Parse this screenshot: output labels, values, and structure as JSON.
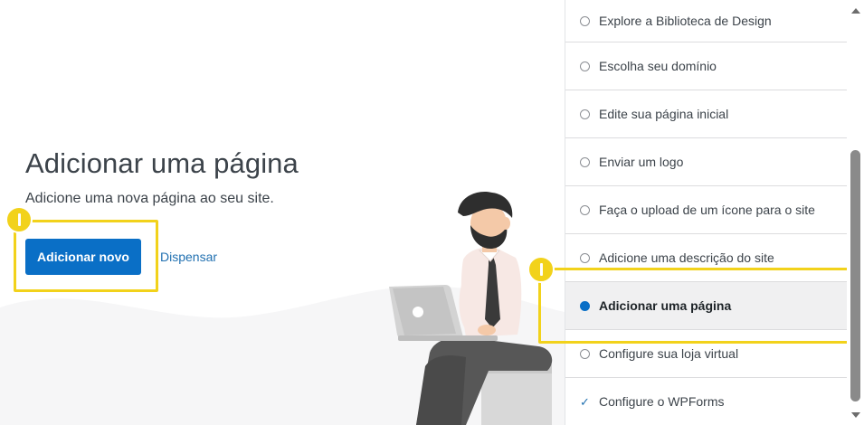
{
  "main": {
    "title": "Adicionar uma página",
    "subtitle": "Adicione uma nova página ao seu site.",
    "primary_button": "Adicionar novo",
    "dismiss_link": "Dispensar"
  },
  "checklist": {
    "items": [
      {
        "label": "Explore a Biblioteca de Design",
        "state": "pending"
      },
      {
        "label": "Escolha seu domínio",
        "state": "pending"
      },
      {
        "label": "Edite sua página inicial",
        "state": "pending"
      },
      {
        "label": "Enviar um logo",
        "state": "pending"
      },
      {
        "label": "Faça o upload de um ícone para o site",
        "state": "pending"
      },
      {
        "label": "Adicione uma descrição do site",
        "state": "pending"
      },
      {
        "label": "Adicionar uma página",
        "state": "active"
      },
      {
        "label": "Configure sua loja virtual",
        "state": "pending"
      },
      {
        "label": "Configure o WPForms",
        "state": "done"
      }
    ]
  },
  "colors": {
    "accent": "#0a6fc6",
    "highlight": "#f2d21b",
    "link": "#2271b1"
  },
  "icons": {
    "check": "✓"
  }
}
